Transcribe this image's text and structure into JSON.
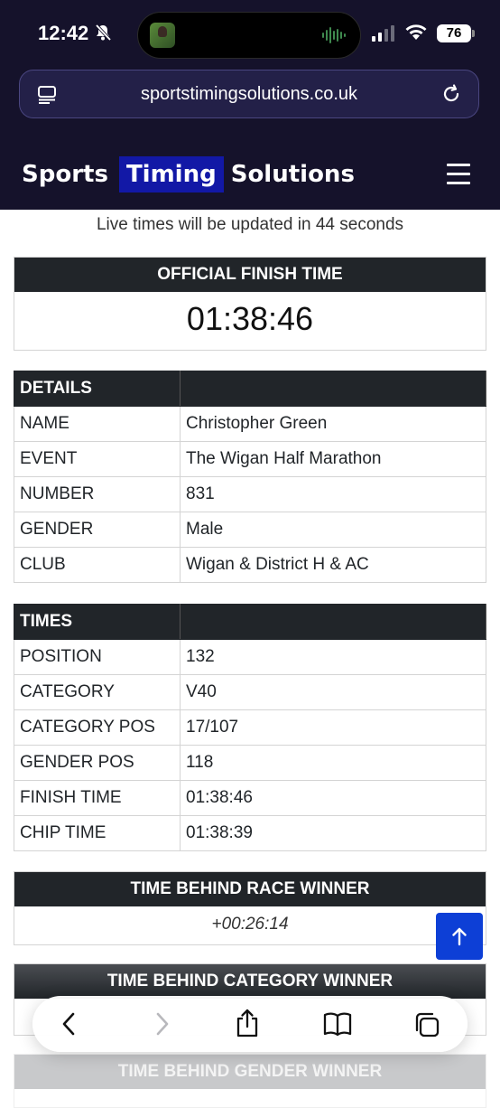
{
  "status_bar": {
    "time": "12:42",
    "battery": "76"
  },
  "browser": {
    "url": "sportstimingsolutions.co.uk"
  },
  "site": {
    "brand_left": "Sports",
    "brand_highlight": "Timing",
    "brand_right": "Solutions"
  },
  "live": {
    "prefix": "Live times will be updated in ",
    "seconds": "44",
    "suffix": " seconds"
  },
  "finish": {
    "heading": "OFFICIAL FINISH TIME",
    "value": "01:38:46"
  },
  "details": {
    "heading": "DETAILS",
    "rows": [
      {
        "label": "NAME",
        "value": "Christopher Green"
      },
      {
        "label": "EVENT",
        "value": "The Wigan Half Marathon"
      },
      {
        "label": "NUMBER",
        "value": "831"
      },
      {
        "label": "GENDER",
        "value": "Male"
      },
      {
        "label": "CLUB",
        "value": "Wigan & District H & AC"
      }
    ]
  },
  "times": {
    "heading": "TIMES",
    "rows": [
      {
        "label": "POSITION",
        "value": "132"
      },
      {
        "label": "CATEGORY",
        "value": "V40"
      },
      {
        "label": "CATEGORY POS",
        "value": "17/107"
      },
      {
        "label": "GENDER POS",
        "value": "118"
      },
      {
        "label": "FINISH TIME",
        "value": "01:38:46"
      },
      {
        "label": "CHIP TIME",
        "value": "01:38:39"
      }
    ]
  },
  "behind_race": {
    "heading": "TIME BEHIND RACE WINNER",
    "value": "+00:26:14"
  },
  "behind_category": {
    "heading": "TIME BEHIND CATEGORY WINNER"
  },
  "behind_gender": {
    "heading": "TIME BEHIND GENDER WINNER"
  },
  "colors": {
    "header_bg": "#15122b",
    "table_head": "#212529",
    "brand_highlight": "#1218a6",
    "scroll_button": "#0d3fd6"
  }
}
